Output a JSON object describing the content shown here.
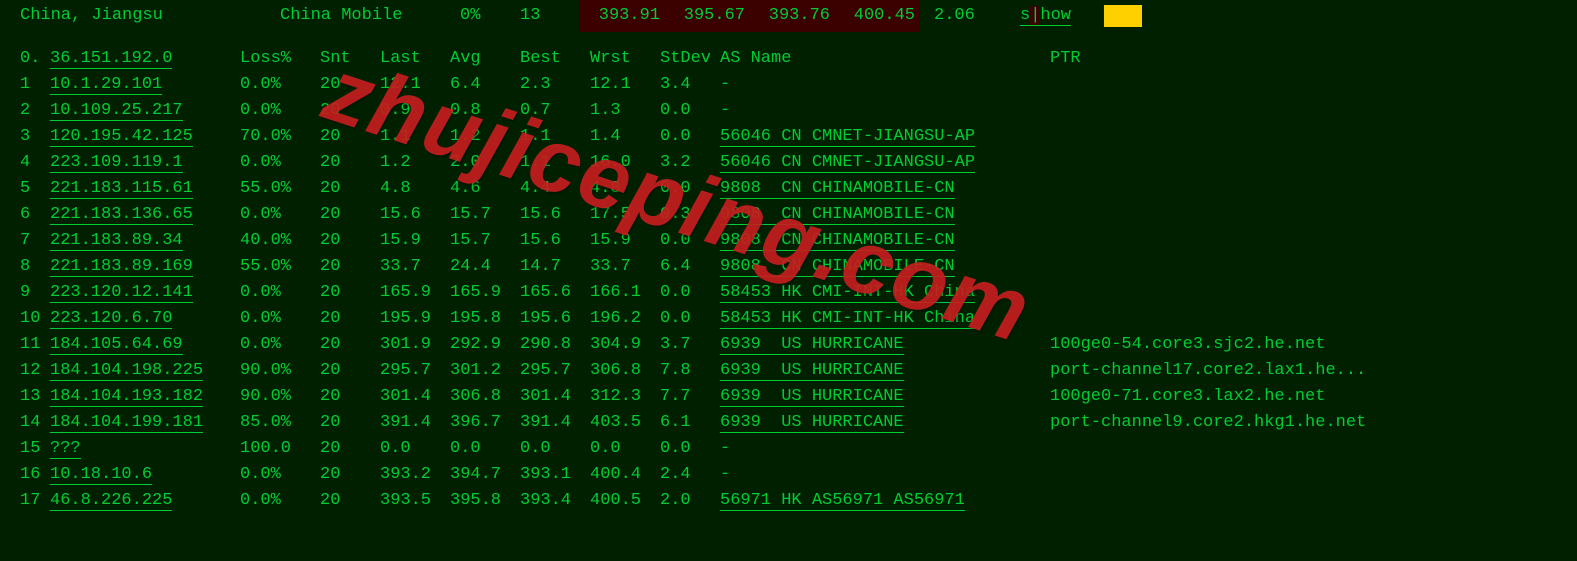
{
  "header": {
    "location": "China, Jiangsu",
    "isp": "China Mobile",
    "pct": "0%",
    "count": "13",
    "lat1": "393.91",
    "lat2": "395.67",
    "lat3": "393.76",
    "lat4": "400.45",
    "stdev": "2.06",
    "show_pre": "s",
    "show_post": "how"
  },
  "column_headers": {
    "idx": "0.",
    "ip": "36.151.192.0",
    "loss": "Loss%",
    "snt": "Snt",
    "last": "Last",
    "avg": "Avg",
    "best": "Best",
    "wrst": "Wrst",
    "stdev": "StDev",
    "asname": "AS Name",
    "ptr": "PTR"
  },
  "hops": [
    {
      "idx": "1",
      "ip": "10.1.29.101",
      "loss": "0.0%",
      "snt": "20",
      "last": "12.1",
      "avg": "6.4",
      "best": "2.3",
      "wrst": "12.1",
      "stdev": "3.4",
      "as": "-",
      "ptr": ""
    },
    {
      "idx": "2",
      "ip": "10.109.25.217",
      "loss": "0.0%",
      "snt": "20",
      "last": "0.9",
      "avg": "0.8",
      "best": "0.7",
      "wrst": "1.3",
      "stdev": "0.0",
      "as": "-",
      "ptr": ""
    },
    {
      "idx": "3",
      "ip": "120.195.42.125",
      "loss": "70.0%",
      "snt": "20",
      "last": "1.1",
      "avg": "1.2",
      "best": "1.1",
      "wrst": "1.4",
      "stdev": "0.0",
      "as": "56046 CN CMNET-JIANGSU-AP",
      "ptr": ""
    },
    {
      "idx": "4",
      "ip": "223.109.119.1",
      "loss": "0.0%",
      "snt": "20",
      "last": "1.2",
      "avg": "2.0",
      "best": "1.1",
      "wrst": "16.0",
      "stdev": "3.2",
      "as": "56046 CN CMNET-JIANGSU-AP",
      "ptr": ""
    },
    {
      "idx": "5",
      "ip": "221.183.115.61",
      "loss": "55.0%",
      "snt": "20",
      "last": "4.8",
      "avg": "4.6",
      "best": "4.4",
      "wrst": "4.8",
      "stdev": "0.0",
      "as": "9808  CN CHINAMOBILE-CN",
      "ptr": ""
    },
    {
      "idx": "6",
      "ip": "221.183.136.65",
      "loss": "0.0%",
      "snt": "20",
      "last": "15.6",
      "avg": "15.7",
      "best": "15.6",
      "wrst": "17.5",
      "stdev": "0.3",
      "as": "9808  CN CHINAMOBILE-CN",
      "ptr": ""
    },
    {
      "idx": "7",
      "ip": "221.183.89.34",
      "loss": "40.0%",
      "snt": "20",
      "last": "15.9",
      "avg": "15.7",
      "best": "15.6",
      "wrst": "15.9",
      "stdev": "0.0",
      "as": "9808  CN CHINAMOBILE-CN",
      "ptr": ""
    },
    {
      "idx": "8",
      "ip": "221.183.89.169",
      "loss": "55.0%",
      "snt": "20",
      "last": "33.7",
      "avg": "24.4",
      "best": "14.7",
      "wrst": "33.7",
      "stdev": "6.4",
      "as": "9808  CN CHINAMOBILE-CN",
      "ptr": ""
    },
    {
      "idx": "9",
      "ip": "223.120.12.141",
      "loss": "0.0%",
      "snt": "20",
      "last": "165.9",
      "avg": "165.9",
      "best": "165.6",
      "wrst": "166.1",
      "stdev": "0.0",
      "as": "58453 HK CMI-INT-HK China",
      "ptr": ""
    },
    {
      "idx": "10",
      "ip": "223.120.6.70",
      "loss": "0.0%",
      "snt": "20",
      "last": "195.9",
      "avg": "195.8",
      "best": "195.6",
      "wrst": "196.2",
      "stdev": "0.0",
      "as": "58453 HK CMI-INT-HK China",
      "ptr": ""
    },
    {
      "idx": "11",
      "ip": "184.105.64.69",
      "loss": "0.0%",
      "snt": "20",
      "last": "301.9",
      "avg": "292.9",
      "best": "290.8",
      "wrst": "304.9",
      "stdev": "3.7",
      "as": "6939  US HURRICANE",
      "ptr": "100ge0-54.core3.sjc2.he.net"
    },
    {
      "idx": "12",
      "ip": "184.104.198.225",
      "loss": "90.0%",
      "snt": "20",
      "last": "295.7",
      "avg": "301.2",
      "best": "295.7",
      "wrst": "306.8",
      "stdev": "7.8",
      "as": "6939  US HURRICANE",
      "ptr": "port-channel17.core2.lax1.he..."
    },
    {
      "idx": "13",
      "ip": "184.104.193.182",
      "loss": "90.0%",
      "snt": "20",
      "last": "301.4",
      "avg": "306.8",
      "best": "301.4",
      "wrst": "312.3",
      "stdev": "7.7",
      "as": "6939  US HURRICANE",
      "ptr": "100ge0-71.core3.lax2.he.net"
    },
    {
      "idx": "14",
      "ip": "184.104.199.181",
      "loss": "85.0%",
      "snt": "20",
      "last": "391.4",
      "avg": "396.7",
      "best": "391.4",
      "wrst": "403.5",
      "stdev": "6.1",
      "as": "6939  US HURRICANE",
      "ptr": "port-channel9.core2.hkg1.he.net"
    },
    {
      "idx": "15",
      "ip": "???",
      "loss": "100.0",
      "snt": "20",
      "last": "0.0",
      "avg": "0.0",
      "best": "0.0",
      "wrst": "0.0",
      "stdev": "0.0",
      "as": "-",
      "ptr": ""
    },
    {
      "idx": "16",
      "ip": "10.18.10.6",
      "loss": "0.0%",
      "snt": "20",
      "last": "393.2",
      "avg": "394.7",
      "best": "393.1",
      "wrst": "400.4",
      "stdev": "2.4",
      "as": "-",
      "ptr": ""
    },
    {
      "idx": "17",
      "ip": "46.8.226.225",
      "loss": "0.0%",
      "snt": "20",
      "last": "393.5",
      "avg": "395.8",
      "best": "393.4",
      "wrst": "400.5",
      "stdev": "2.0",
      "as": "56971 HK AS56971 AS56971",
      "ptr": ""
    }
  ],
  "watermark": "zhujiceping.com"
}
